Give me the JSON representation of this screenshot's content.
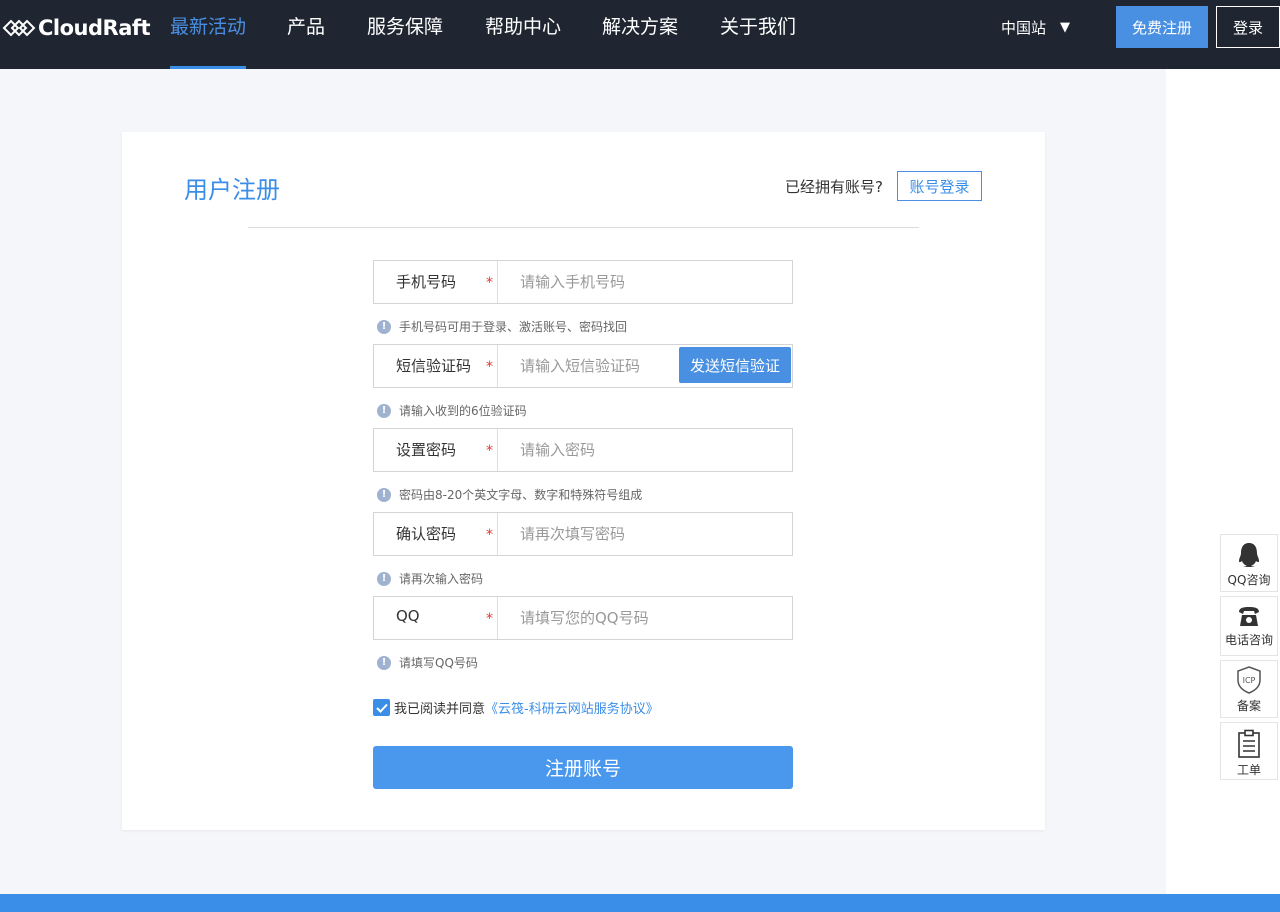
{
  "brand": {
    "name": "CloudRaft"
  },
  "nav": {
    "items": [
      {
        "label": "最新活动",
        "active": true
      },
      {
        "label": "产品",
        "active": false
      },
      {
        "label": "服务保障",
        "active": false
      },
      {
        "label": "帮助中心",
        "active": false
      },
      {
        "label": "解决方案",
        "active": false
      },
      {
        "label": "关于我们",
        "active": false
      }
    ],
    "site": "中国站",
    "site_caret": "▼",
    "register_label": "免费注册",
    "login_label": "登录"
  },
  "form": {
    "title": "用户注册",
    "have_account": "已经拥有账号?",
    "account_login": "账号登录",
    "fields": [
      {
        "label": "手机号码",
        "required": "*",
        "placeholder": "请输入手机号码",
        "value": "",
        "hint": "手机号码可用于登录、激活账号、密码找回"
      },
      {
        "label": "短信验证码",
        "required": "*",
        "placeholder": "请输入短信验证码",
        "value": "",
        "hint": "请输入收到的6位验证码",
        "action": "发送短信验证"
      },
      {
        "label": "设置密码",
        "required": "*",
        "placeholder": "请输入密码",
        "value": "",
        "hint": "密码由8-20个英文字母、数字和特殊符号组成"
      },
      {
        "label": "确认密码",
        "required": "*",
        "placeholder": "请再次填写密码",
        "value": "",
        "hint": "请再次输入密码"
      },
      {
        "label": "QQ",
        "required": "*",
        "placeholder": "请填写您的QQ号码",
        "value": "",
        "hint": "请填写QQ号码"
      }
    ],
    "hint_icon": "!",
    "agree_checked": true,
    "agree_text": "我已阅读并同意",
    "agree_link": "《云筏-科研云网站服务协议》",
    "submit_label": "注册账号"
  },
  "side_tools": [
    {
      "label": "QQ咨询",
      "icon": "qq-icon"
    },
    {
      "label": "电话咨询",
      "icon": "phone-icon"
    },
    {
      "label": "备案",
      "icon": "icp-icon"
    },
    {
      "label": "工单",
      "icon": "ticket-icon"
    }
  ],
  "icp_text": "ICP",
  "colors": {
    "accent": "#3b8ee8",
    "topbar": "#1f2631",
    "required": "#e33333"
  }
}
